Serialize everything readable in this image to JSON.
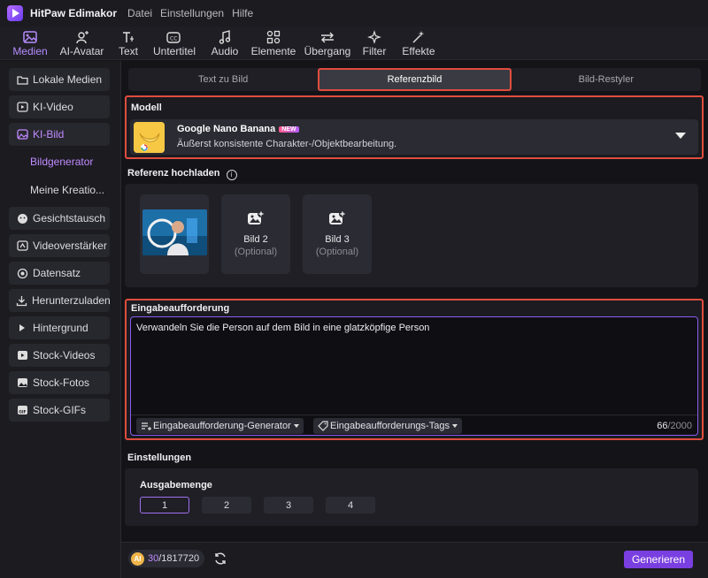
{
  "app": {
    "name": "HitPaw Edimakor"
  },
  "menu": [
    "Datei",
    "Einstellungen",
    "Hilfe"
  ],
  "toolbar": [
    {
      "label": "Medien",
      "icon": "media-icon",
      "active": true
    },
    {
      "label": "AI-Avatar",
      "icon": "avatar-icon",
      "active": false
    },
    {
      "label": "Text",
      "icon": "text-icon",
      "active": false
    },
    {
      "label": "Untertitel",
      "icon": "subtitle-icon",
      "active": false
    },
    {
      "label": "Audio",
      "icon": "audio-icon",
      "active": false
    },
    {
      "label": "Elemente",
      "icon": "elements-icon",
      "active": false
    },
    {
      "label": "Übergang",
      "icon": "transition-icon",
      "active": false
    },
    {
      "label": "Filter",
      "icon": "filter-icon",
      "active": false
    },
    {
      "label": "Effekte",
      "icon": "effects-icon",
      "active": false
    }
  ],
  "sidebar": {
    "items": [
      {
        "label": "Lokale Medien",
        "icon": "folder-icon"
      },
      {
        "label": "KI-Video",
        "icon": "ai-video-icon"
      },
      {
        "label": "KI-Bild",
        "icon": "ai-image-icon"
      },
      {
        "label": "Bildgenerator"
      },
      {
        "label": "Meine Kreatio..."
      },
      {
        "label": "Gesichtstausch",
        "icon": "face-swap-icon"
      },
      {
        "label": "Videoverstärker",
        "icon": "video-enhancer-icon"
      },
      {
        "label": "Datensatz",
        "icon": "dataset-icon"
      },
      {
        "label": "Herunterzuladen",
        "icon": "download-icon"
      },
      {
        "label": "Hintergrund",
        "icon": "background-icon"
      },
      {
        "label": "Stock-Videos",
        "icon": "stock-video-icon"
      },
      {
        "label": "Stock-Fotos",
        "icon": "stock-photo-icon"
      },
      {
        "label": "Stock-GIFs",
        "icon": "gif-icon"
      }
    ]
  },
  "tabs": [
    {
      "label": "Text zu Bild",
      "active": false
    },
    {
      "label": "Referenzbild",
      "active": true
    },
    {
      "label": "Bild-Restyler",
      "active": false
    }
  ],
  "model": {
    "section_title": "Modell",
    "name": "Google Nano Banana",
    "badge": "NEW",
    "description": "Äußerst konsistente Charakter-/Objektbearbeitung."
  },
  "reference": {
    "section_title": "Referenz hochladen",
    "info": "i",
    "slots": [
      {
        "name": "",
        "optional": ""
      },
      {
        "name": "Bild 2",
        "optional": "(Optional)"
      },
      {
        "name": "Bild 3",
        "optional": "(Optional)"
      }
    ]
  },
  "prompt": {
    "section_title": "Eingabeaufforderung",
    "text": "Verwandeln Sie die Person auf dem Bild in eine glatzköpfige Person",
    "generator_label": "Eingabeaufforderung-Generator",
    "tags_label": "Eingabeaufforderungs-Tags",
    "count": "66",
    "max": "/2000"
  },
  "settings": {
    "section_title": "Einstellungen",
    "quantity_label": "Ausgabemenge",
    "quantities": [
      "1",
      "2",
      "3",
      "4"
    ],
    "selected": "1"
  },
  "footer": {
    "coin_label": "AI",
    "credits_used": "30",
    "credits_total": "/1817720",
    "generate_label": "Generieren"
  },
  "colors": {
    "accent": "#7a3fe0",
    "highlight_border": "#e04d3e",
    "active_text": "#c08bff"
  }
}
